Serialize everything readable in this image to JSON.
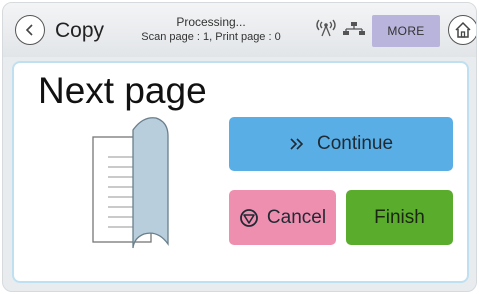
{
  "header": {
    "title": "Copy",
    "status_line1": "Processing...",
    "status_line2": "Scan page : 1, Print page : 0",
    "more_label": "MORE"
  },
  "main": {
    "heading": "Next page",
    "continue_label": "Continue",
    "cancel_label": "Cancel",
    "finish_label": "Finish"
  },
  "icons": {
    "back": "back-arrow-icon",
    "wireless": "wireless-signal-icon",
    "network": "network-icon",
    "home": "home-icon",
    "continue": "double-chevron-right-icon",
    "cancel": "stop-icon",
    "illustration": "page-turn-icon"
  },
  "colors": {
    "continue": "#5aaee6",
    "cancel": "#ef8fb0",
    "finish": "#5aad2c",
    "more": "#b9b4dc",
    "panel_border": "#bfe0f1"
  }
}
